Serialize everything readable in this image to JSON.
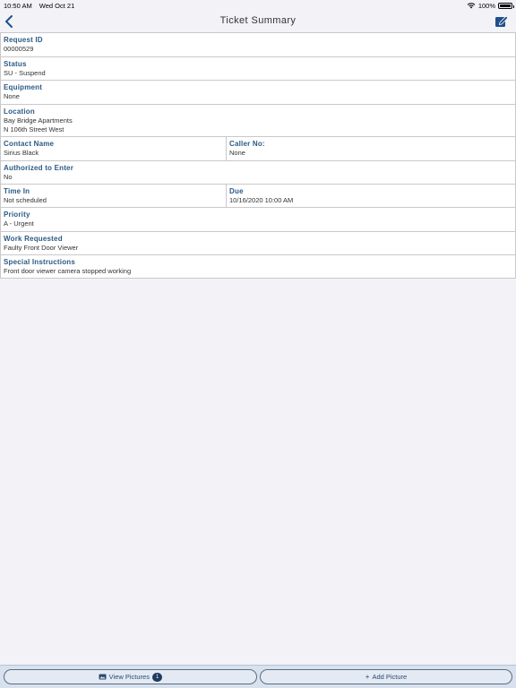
{
  "status_bar": {
    "time": "10:50 AM",
    "date": "Wed Oct 21",
    "battery": "100%"
  },
  "nav": {
    "title": "Ticket Summary",
    "back_icon": "chevron-left-icon",
    "edit_icon": "compose-icon"
  },
  "fields": {
    "request_id": {
      "label": "Request ID",
      "value": "00000529"
    },
    "status": {
      "label": "Status",
      "value": "SU - Suspend"
    },
    "equipment": {
      "label": "Equipment",
      "value": "None"
    },
    "location": {
      "label": "Location",
      "line1": "Bay Bridge Apartments",
      "line2": "N 106th Street West"
    },
    "contact_name": {
      "label": "Contact Name",
      "value": "Sirius Black"
    },
    "caller_no": {
      "label": "Caller No:",
      "value": "None"
    },
    "authorized": {
      "label": "Authorized to Enter",
      "value": "No"
    },
    "time_in": {
      "label": "Time In",
      "value": "Not scheduled"
    },
    "due": {
      "label": "Due",
      "value": "10/16/2020 10:00 AM"
    },
    "priority": {
      "label": "Priority",
      "value": "A - Urgent"
    },
    "work_requested": {
      "label": "Work Requested",
      "value": "Faulty Front Door Viewer"
    },
    "special_instructions": {
      "label": "Special Instructions",
      "value": "Front door viewer camera stopped working"
    }
  },
  "toolbar": {
    "view_pictures_label": "View Pictures",
    "view_pictures_count": "1",
    "add_picture_plus": "+",
    "add_picture_label": "Add Picture"
  },
  "colors": {
    "label": "#2a5a86",
    "accent": "#1e4f8a",
    "toolbar_bg": "#d8e2ef"
  }
}
